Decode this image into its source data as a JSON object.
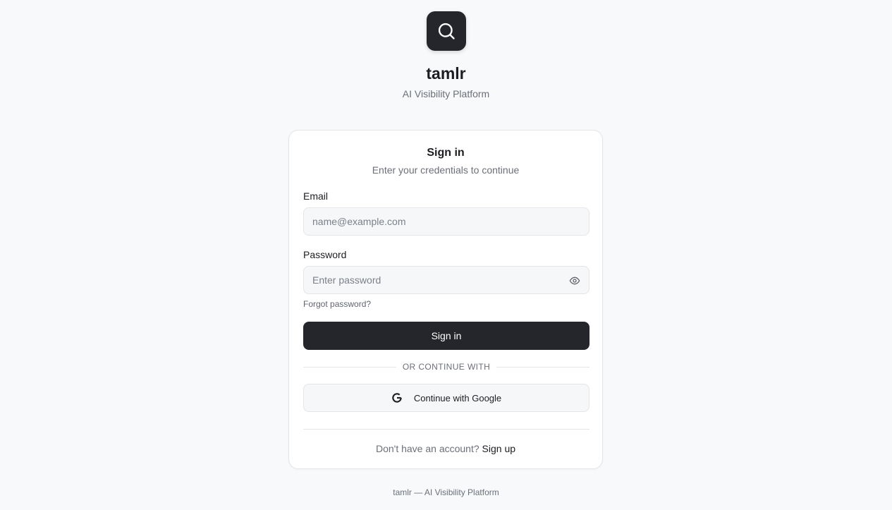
{
  "brand": {
    "logo_icon": "search-icon",
    "name": "tamlr",
    "tagline": "AI Visibility Platform"
  },
  "signin": {
    "title": "Sign in",
    "subtitle": "Enter your credentials to continue",
    "email_label": "Email",
    "email_placeholder": "name@example.com",
    "password_label": "Password",
    "password_placeholder": "Enter password",
    "password_toggle_icon": "eye-icon",
    "forgot_label": "Forgot password?",
    "submit_label": "Sign in",
    "divider_label": "OR CONTINUE WITH",
    "google_label": "Continue with Google",
    "google_icon": "google-icon",
    "no_account_text": "Don't have an account?",
    "signup_label": "Sign up"
  },
  "footer": {
    "text": "tamlr — AI Visibility Platform"
  },
  "colors": {
    "background": "#f8f9fb",
    "primary": "#25262b",
    "muted_text": "#6b6f78",
    "border": "#e3e5e9"
  }
}
